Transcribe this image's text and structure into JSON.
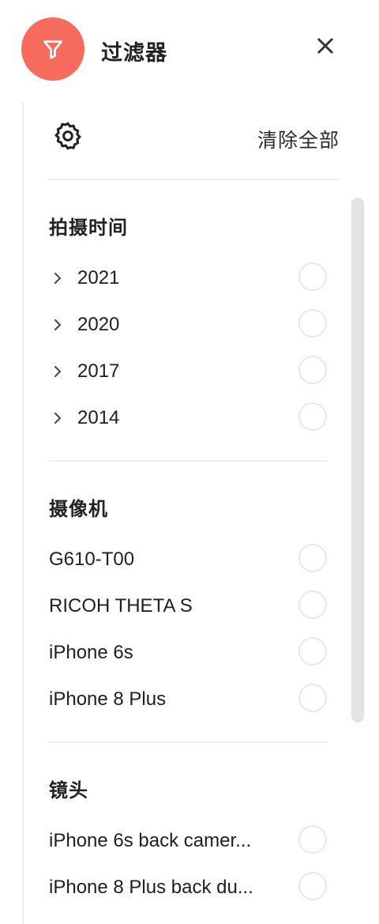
{
  "header": {
    "title": "过滤器"
  },
  "toolbar": {
    "clear_all": "清除全部"
  },
  "sections": {
    "capture_time": {
      "title": "拍摄时间",
      "items": [
        {
          "label": "2021"
        },
        {
          "label": "2020"
        },
        {
          "label": "2017"
        },
        {
          "label": "2014"
        }
      ]
    },
    "camera": {
      "title": "摄像机",
      "items": [
        {
          "label": "G610-T00"
        },
        {
          "label": "RICOH THETA S"
        },
        {
          "label": "iPhone 6s"
        },
        {
          "label": "iPhone 8 Plus"
        }
      ]
    },
    "lens": {
      "title": "镜头",
      "items": [
        {
          "label": "iPhone 6s back camer..."
        },
        {
          "label": "iPhone 8 Plus back du..."
        }
      ]
    }
  },
  "colors": {
    "accent": "#f76b5e",
    "divider": "#eceef2",
    "radio_border": "#e6e8ee",
    "scrollbar": "#e2e3e5"
  },
  "icons": {
    "header_badge": "filter-icon",
    "close": "close-icon",
    "settings": "gear-icon",
    "expand": "chevron-right-icon",
    "selection": "radio-unchecked-icon"
  }
}
